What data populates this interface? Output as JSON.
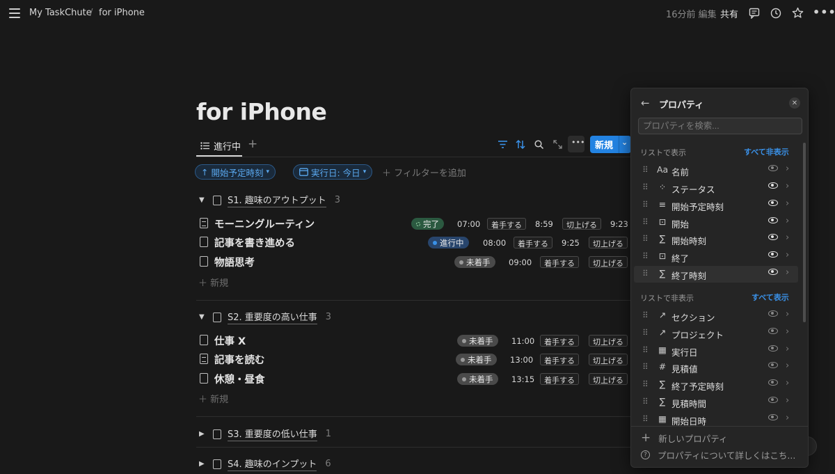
{
  "topbar": {
    "breadcrumb": [
      "My TaskChute",
      "/",
      "for iPhone"
    ],
    "edited": "16分前 編集",
    "share": "共有"
  },
  "page": {
    "title": "for iPhone"
  },
  "view": {
    "tab_label": "進行中",
    "add": "+",
    "new_label": "新規"
  },
  "filters": {
    "sort_chip": "開始予定時刻",
    "date_chip": "実行日: 今日",
    "add_filter": "フィルターを追加"
  },
  "groups": [
    {
      "name": "S1. 趣味のアウトプット",
      "count": "3",
      "expanded": true,
      "tasks": [
        {
          "name": "モーニングルーティン",
          "doc_lines": true,
          "status": "完了",
          "status_type": "done",
          "start": "07:00",
          "btn1": "着手する",
          "time2": "8:59",
          "btn2": "切上げる",
          "time3": "9:23"
        },
        {
          "name": "記事を書き進める",
          "doc_lines": false,
          "status": "進行中",
          "status_type": "prog",
          "start": "08:00",
          "btn1": "着手する",
          "time2": "9:25",
          "btn2": "切上げる",
          "time3": ""
        },
        {
          "name": "物語思考",
          "doc_lines": false,
          "status": "未着手",
          "status_type": "todo",
          "start": "09:00",
          "btn1": "着手する",
          "time2": "",
          "btn2": "切上げる",
          "time3": ""
        }
      ],
      "new_label": "新規"
    },
    {
      "name": "S2. 重要度の高い仕事",
      "count": "3",
      "expanded": true,
      "tasks": [
        {
          "name": "仕事 X",
          "doc_lines": false,
          "status": "未着手",
          "status_type": "todo",
          "start": "11:00",
          "btn1": "着手する",
          "time2": "",
          "btn2": "切上げる",
          "time3": ""
        },
        {
          "name": "記事を読む",
          "doc_lines": true,
          "status": "未着手",
          "status_type": "todo",
          "start": "13:00",
          "btn1": "着手する",
          "time2": "",
          "btn2": "切上げる",
          "time3": ""
        },
        {
          "name": "休憩・昼食",
          "doc_lines": false,
          "status": "未着手",
          "status_type": "todo",
          "start": "13:15",
          "btn1": "着手する",
          "time2": "",
          "btn2": "切上げる",
          "time3": ""
        }
      ],
      "new_label": "新規"
    },
    {
      "name": "S3. 重要度の低い仕事",
      "count": "1",
      "expanded": false
    },
    {
      "name": "S4. 趣味のインプット",
      "count": "6",
      "expanded": false
    }
  ],
  "colors": {
    "accent": "#2383e2",
    "done": "#2b5940",
    "in_progress": "#28456c",
    "todo": "#4a4a4a"
  },
  "panel": {
    "back_icon": "arrow-left-icon",
    "title": "プロパティ",
    "search_placeholder": "プロパティを検索...",
    "shown_header": "リストで表示",
    "hide_all": "すべて非表示",
    "hidden_header": "リストで非表示",
    "show_all": "すべて表示",
    "shown": [
      {
        "icon": "Aa",
        "name": "名前",
        "visible": true
      },
      {
        "icon": "⁘",
        "name": "ステータス",
        "visible": true
      },
      {
        "icon": "≡",
        "name": "開始予定時刻",
        "visible": true
      },
      {
        "icon": "⊡",
        "name": "開始",
        "visible": true
      },
      {
        "icon": "∑",
        "name": "開始時刻",
        "visible": true
      },
      {
        "icon": "⊡",
        "name": "終了",
        "visible": true
      },
      {
        "icon": "∑",
        "name": "終了時刻",
        "visible": true
      }
    ],
    "hidden": [
      {
        "icon": "↗",
        "name": "セクション",
        "visible": false
      },
      {
        "icon": "↗",
        "name": "プロジェクト",
        "visible": false
      },
      {
        "icon": "▦",
        "name": "実行日",
        "visible": false
      },
      {
        "icon": "#",
        "name": "見積値",
        "visible": false
      },
      {
        "icon": "∑",
        "name": "終了予定時刻",
        "visible": false
      },
      {
        "icon": "∑",
        "name": "見積時間",
        "visible": false
      },
      {
        "icon": "▦",
        "name": "開始日時",
        "visible": false
      }
    ],
    "new_property": "新しいプロパティ",
    "learn_more": "プロパティについて詳しくはこち..."
  }
}
